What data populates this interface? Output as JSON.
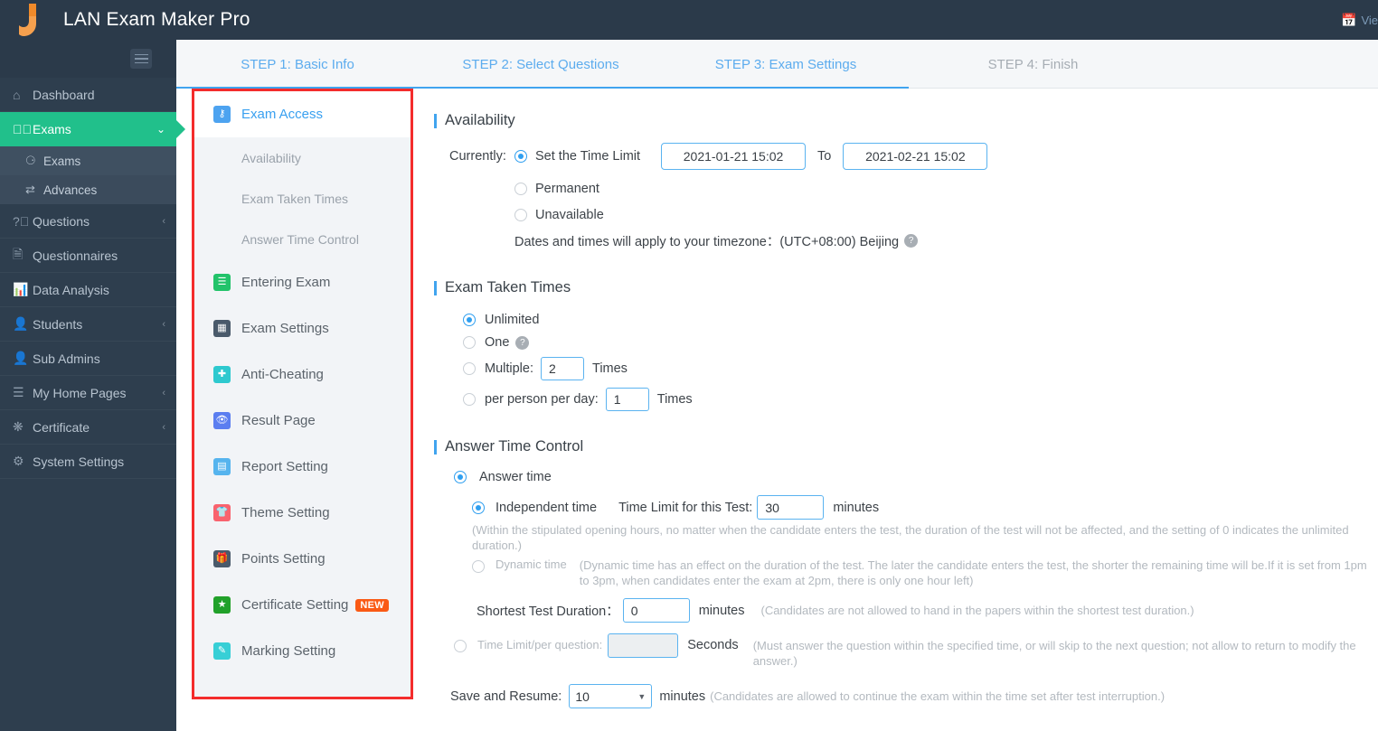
{
  "header": {
    "brand_title": "LAN Exam Maker Pro",
    "logo_icon": "j-logo-icon",
    "right_action": {
      "icon": "calendar-icon",
      "label": "Vie"
    }
  },
  "sidebar": {
    "toggle_icon": "hamburger-icon",
    "items": [
      {
        "label": "Dashboard",
        "icon": "home-icon",
        "caret": "",
        "state": "normal"
      },
      {
        "label": "Exams",
        "icon": "check-circle-icon",
        "caret": "⌄",
        "state": "active"
      },
      {
        "label": "Questions",
        "icon": "question-circle-icon",
        "caret": "‹",
        "state": "normal"
      },
      {
        "label": "Questionnaires",
        "icon": "documents-icon",
        "caret": "",
        "state": "normal"
      },
      {
        "label": "Data Analysis",
        "icon": "bar-chart-icon",
        "caret": "",
        "state": "normal"
      },
      {
        "label": "Students",
        "icon": "user-icon",
        "caret": "‹",
        "state": "normal"
      },
      {
        "label": "Sub Admins",
        "icon": "user-icon",
        "caret": "",
        "state": "normal"
      },
      {
        "label": "My Home Pages",
        "icon": "layers-icon",
        "caret": "‹",
        "state": "normal"
      },
      {
        "label": "Certificate",
        "icon": "rosette-icon",
        "caret": "‹",
        "state": "normal"
      },
      {
        "label": "System Settings",
        "icon": "gear-icon",
        "caret": "",
        "state": "normal"
      }
    ],
    "sub_items": [
      {
        "label": "Exams",
        "icon": "check-circle-icon",
        "state": "sub-active"
      },
      {
        "label": "Advances",
        "icon": "shuffle-icon",
        "state": "normal"
      }
    ]
  },
  "steps": [
    {
      "label": "STEP 1: Basic Info",
      "state": "done"
    },
    {
      "label": "STEP 2: Select Questions",
      "state": "done"
    },
    {
      "label": "STEP 3: Exam Settings",
      "state": "current"
    },
    {
      "label": "STEP 4: Finish",
      "state": "inactive"
    }
  ],
  "settings_panel": {
    "items": [
      {
        "label": "Exam Access",
        "icon": "shield-access-icon",
        "color": "#4da3f0",
        "state": "current"
      },
      {
        "label": "Availability",
        "icon": "",
        "type": "sub"
      },
      {
        "label": "Exam Taken Times",
        "icon": "",
        "type": "sub"
      },
      {
        "label": "Answer Time Control",
        "icon": "",
        "type": "sub"
      },
      {
        "label": "Entering Exam",
        "icon": "list-doc-icon",
        "color": "#22c36a"
      },
      {
        "label": "Exam Settings",
        "icon": "grid-settings-icon",
        "color": "#4a5a6b"
      },
      {
        "label": "Anti-Cheating",
        "icon": "shield-plus-icon",
        "color": "#2ec9cf"
      },
      {
        "label": "Result Page",
        "icon": "eye-icon",
        "color": "#5b7ef0"
      },
      {
        "label": "Report Setting",
        "icon": "report-icon",
        "color": "#56b4ee"
      },
      {
        "label": "Theme Setting",
        "icon": "shirt-icon",
        "color": "#f9636e"
      },
      {
        "label": "Points Setting",
        "icon": "gift-icon",
        "color": "#4a5a6b"
      },
      {
        "label": "Certificate Setting",
        "icon": "rosette-star-icon",
        "color": "#21a12a",
        "badge": "NEW"
      },
      {
        "label": "Marking Setting",
        "icon": "marking-doc-icon",
        "color": "#37cfd6"
      }
    ]
  },
  "availability": {
    "title": "Availability",
    "currently_label": "Currently:",
    "option_time_limit": "Set the Time Limit",
    "date_from": "2021-01-21 15:02",
    "to_label": "To",
    "date_to": "2021-02-21 15:02",
    "option_permanent": "Permanent",
    "option_unavailable": "Unavailable",
    "timezone_note": "Dates and times will apply to your timezone：(UTC+08:00) Beijing",
    "help_icon": "question-mark-icon"
  },
  "exam_taken_times": {
    "title": "Exam Taken Times",
    "option_unlimited": "Unlimited",
    "option_one": "One",
    "one_help_icon": "question-mark-icon",
    "option_multiple": "Multiple:",
    "multiple_value": "2",
    "multiple_unit": "Times",
    "option_per_day": "per person per day:",
    "per_day_value": "1",
    "per_day_unit": "Times"
  },
  "answer_time_control": {
    "title": "Answer Time Control",
    "option_answer_time": "Answer time",
    "independent_time_label": "Independent time",
    "time_limit_label": "Time Limit for this Test:",
    "time_limit_value": "30",
    "minutes_unit": "minutes",
    "independent_hint": "(Within the stipulated opening hours, no matter when the candidate enters the test, the duration of the test will not be affected, and the setting of 0 indicates the unlimited duration.)",
    "dynamic_time_label": "Dynamic time",
    "dynamic_hint": "(Dynamic time has an effect on the duration of the test. The later the candidate enters the test, the shorter the remaining time will be.If it is set from 1pm to 3pm, when candidates enter the exam at 2pm, there is only one hour left)",
    "shortest_label": "Shortest Test Duration：",
    "shortest_value": "0",
    "shortest_unit": "minutes",
    "shortest_hint": "(Candidates are not allowed to hand in the papers within the shortest test duration.)",
    "per_question_label": "Time Limit/per question:",
    "per_question_value": "",
    "per_question_unit": "Seconds",
    "per_question_hint": "(Must answer the question within the specified time, or will skip to the next question; not allow to return to modify the answer.)"
  },
  "save_resume": {
    "label": "Save and Resume:",
    "value": "10",
    "unit": "minutes",
    "hint": "(Candidates are allowed to continue the exam within the time set after test interruption.)",
    "caret_icon": "chevron-down-icon"
  },
  "colors": {
    "sidebar_bg": "#2e3e4e",
    "topbar_bg": "#2b3a4a",
    "accent_green": "#21c08b",
    "accent_blue": "#40a4ef",
    "highlight_red": "#f42c2c",
    "badge_orange": "#fa5a15"
  }
}
